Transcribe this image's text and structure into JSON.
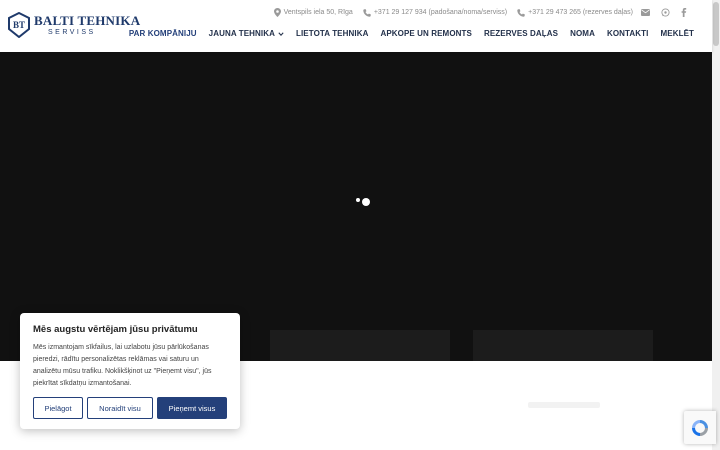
{
  "brand": {
    "title": "BALTI TEHNIKA",
    "subtitle": "SERVISS",
    "badge_icon": "bt-shield-logo",
    "color": "#1f3a6b"
  },
  "topbar": {
    "address": "Ventspils iela 50, Rīga",
    "phone1": "+371 29 127 934 (padošana/noma/serviss)",
    "phone2": "+371 29 473 265 (rezerves daļas)",
    "icons": [
      "map-pin-icon",
      "phone-icon",
      "phone-icon",
      "mail-icon",
      "whatsapp-icon",
      "facebook-icon"
    ]
  },
  "nav": {
    "items": [
      {
        "label": "PAR KOMPĀNIJU"
      },
      {
        "label": "JAUNA TEHNIKA"
      },
      {
        "label": "LIETOTA TEHNIKA"
      },
      {
        "label": "APKOPE UN REMONTS"
      },
      {
        "label": "REZERVES DAĻAS"
      },
      {
        "label": "NOMA"
      },
      {
        "label": "KONTAKTI"
      },
      {
        "label": "MEKLĒT"
      }
    ],
    "active_color": "#24407a"
  },
  "cookie": {
    "title": "Mēs augstu vērtējam jūsu privātumu",
    "text": "Mēs izmantojam sīkfailus, lai uzlabotu jūsu pārlūkošanas pieredzi, rādītu personalizētas reklāmas vai saturu un analizētu mūsu trafiku. Noklikšķinot uz \"Pieņemt visu\", jūs piekrītat sīkdatņu izmantošanai.",
    "customize": "Pielāgot",
    "reject": "Noraidīt visu",
    "accept": "Pieņemt visus",
    "accent": "#24407a"
  },
  "hero": {
    "background": "#111111"
  }
}
